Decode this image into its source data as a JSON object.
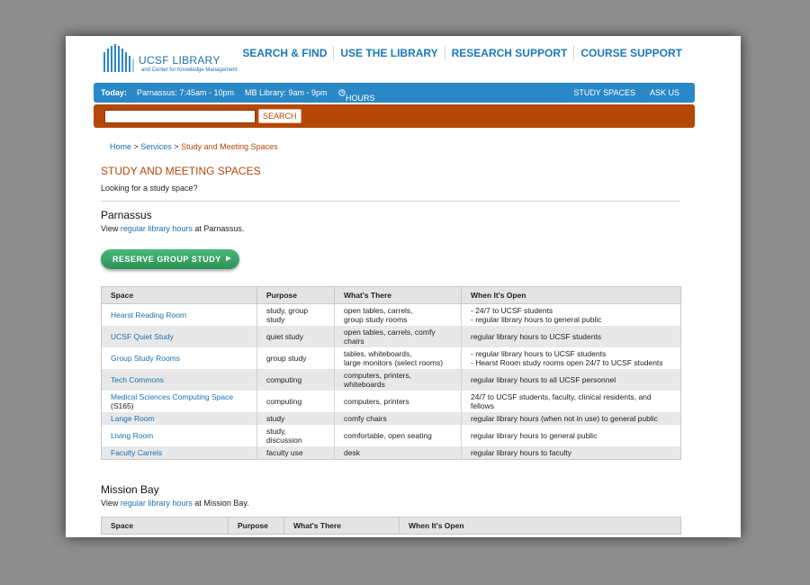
{
  "header": {
    "logo_name": "UCSF LIBRARY",
    "logo_sub": "and Center for Knowledge Management",
    "nav": [
      "SEARCH & FIND",
      "USE THE LIBRARY",
      "RESEARCH SUPPORT",
      "COURSE SUPPORT"
    ]
  },
  "hours_bar": {
    "today_label": "Today:",
    "parnassus": "Parnassus: 7:45am - 10pm",
    "mb": "MB Library: 9am - 9pm",
    "hours_link": "HOURS",
    "study_spaces": "STUDY SPACES",
    "ask_us": "ASK US"
  },
  "search": {
    "value": "",
    "button": "SEARCH"
  },
  "breadcrumb": {
    "home": "Home",
    "sep": " > ",
    "services": "Services",
    "current": "Study and Meeting Spaces"
  },
  "page_title": "STUDY AND MEETING SPACES",
  "intro": "Looking for a study space?",
  "parnassus": {
    "heading": "Parnassus",
    "view_pre": "View ",
    "view_link": "regular library hours",
    "view_post": " at Parnassus.",
    "reserve_button": "RESERVE GROUP STUDY",
    "columns": [
      "Space",
      "Purpose",
      "What's There",
      "When It's Open"
    ],
    "rows": [
      {
        "space": "Hearst Reading Room",
        "note": "",
        "purpose": "study, group\nstudy",
        "there": "open tables, carrels,\ngroup study rooms",
        "open": "- 24/7 to UCSF students\n- regular library hours to general public"
      },
      {
        "space": "UCSF Quiet Study",
        "note": "",
        "purpose": "quiet study",
        "there": "open tables, carrels, comfy\nchairs",
        "open": "regular library hours to UCSF students"
      },
      {
        "space": "Group Study Rooms",
        "note": "",
        "purpose": "group study",
        "there": "tables, whiteboards,\nlarge monitors (select rooms)",
        "open": "- regular library hours to UCSF students\n- Hearst Room study rooms open 24/7 to UCSF students"
      },
      {
        "space": "Tech Commons",
        "note": "",
        "purpose": "computing",
        "there": "computers, printers,\nwhiteboards",
        "open": "regular library hours to all UCSF personnel"
      },
      {
        "space": "Medical Sciences Computing Space",
        "note": "(S165)",
        "purpose": "computing",
        "there": "computers, printers",
        "open": "24/7 to UCSF students, faculty, clinical residents, and\nfellows"
      },
      {
        "space": "Lange Room",
        "note": "",
        "purpose": "study",
        "there": "comfy chairs",
        "open": "regular library hours (when not in use) to general public"
      },
      {
        "space": "Living Room",
        "note": "",
        "purpose": "study,\ndiscussion",
        "there": "comfortable, open seating",
        "open": "regular library hours to general public"
      },
      {
        "space": "Faculty Carrels",
        "note": "",
        "purpose": "faculty use",
        "there": "desk",
        "open": "regular library hours to faculty"
      }
    ]
  },
  "mission_bay": {
    "heading": "Mission Bay",
    "view_pre": "View ",
    "view_link": "regular library hours",
    "view_post": " at Mission Bay.",
    "columns": [
      "Space",
      "Purpose",
      "What's There",
      "When It's Open"
    ]
  }
}
